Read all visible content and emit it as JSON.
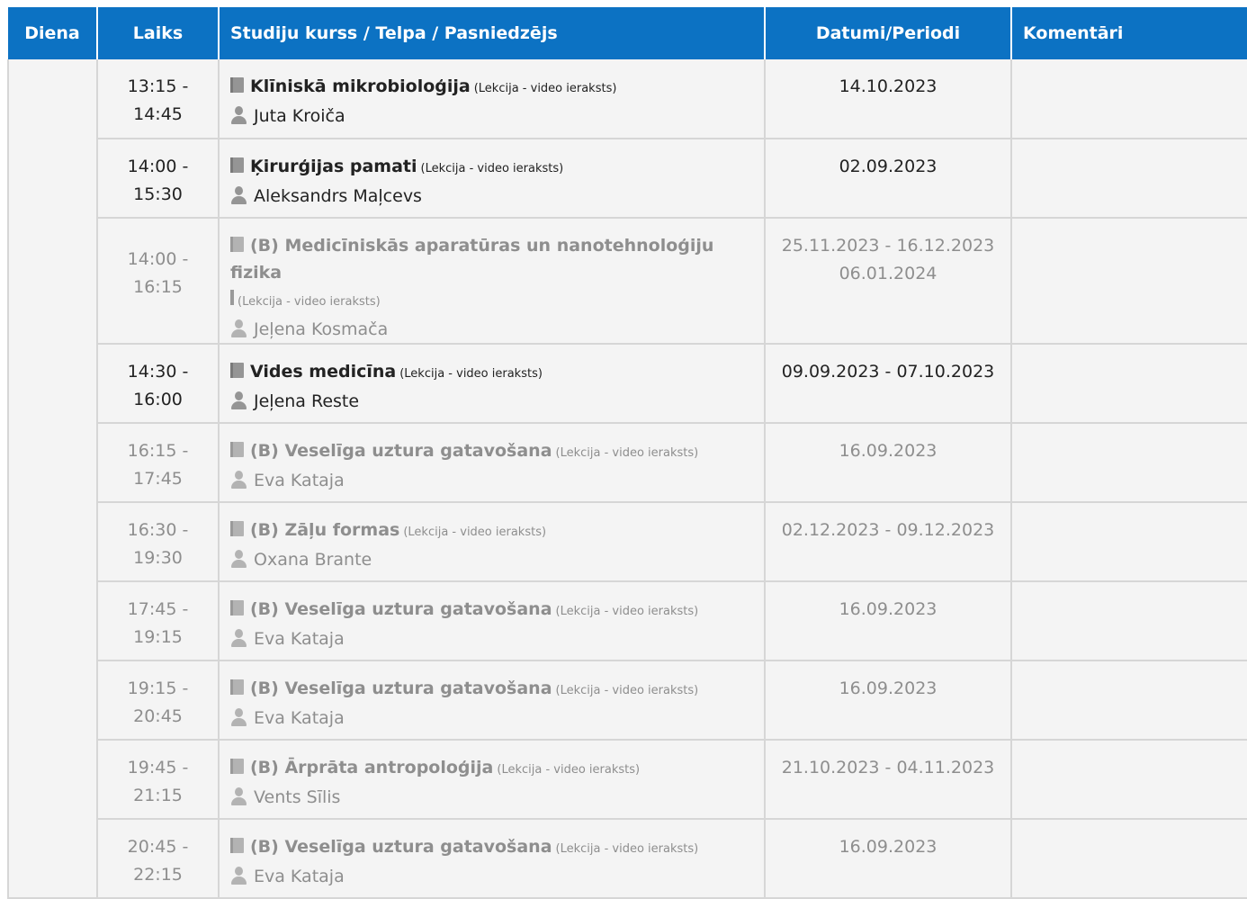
{
  "header": {
    "day": "Diena",
    "time": "Laiks",
    "course": "Studiju kurss / Telpa / Pasniedzējs",
    "dates": "Datumi/Periodi",
    "comments": "Komentāri"
  },
  "colors": {
    "header_bg": "#0c72c3",
    "cell_bg": "#f4f4f4",
    "dim_text": "#8e8e8e"
  },
  "rows": [
    {
      "time_start": "13:15 -",
      "time_end": "14:45",
      "course": "Klīniskā mikrobioloģija",
      "type": "(Lekcija - video ieraksts)",
      "teacher": "Juta Kroiča",
      "dates": "14.10.2023",
      "dates2": "",
      "dim": false
    },
    {
      "time_start": "14:00 -",
      "time_end": "15:30",
      "course": "Ķirurģijas pamati",
      "type": "(Lekcija - video ieraksts)",
      "teacher": "Aleksandrs Maļcevs",
      "dates": "02.09.2023",
      "dates2": "",
      "dim": false
    },
    {
      "time_start": "14:00 -",
      "time_end": "16:15",
      "course": "(B) Medicīniskās aparatūras un nanotehnoloģiju fizika",
      "type": "(Lekcija - video ieraksts)",
      "teacher": "Jeļena Kosmača",
      "dates": "25.11.2023 - 16.12.2023",
      "dates2": "06.01.2024",
      "dim": true
    },
    {
      "time_start": "14:30 -",
      "time_end": "16:00",
      "course": "Vides medicīna",
      "type": "(Lekcija - video ieraksts)",
      "teacher": "Jeļena Reste",
      "dates": "09.09.2023 - 07.10.2023",
      "dates2": "",
      "dim": false
    },
    {
      "time_start": "16:15 -",
      "time_end": "17:45",
      "course": "(B) Veselīga uztura gatavošana",
      "type": "(Lekcija - video ieraksts)",
      "teacher": "Eva Kataja",
      "dates": "16.09.2023",
      "dates2": "",
      "dim": true
    },
    {
      "time_start": "16:30 -",
      "time_end": "19:30",
      "course": "(B) Zāļu formas",
      "type": "(Lekcija - video ieraksts)",
      "teacher": "Oxana Brante",
      "dates": "02.12.2023 - 09.12.2023",
      "dates2": "",
      "dim": true
    },
    {
      "time_start": "17:45 -",
      "time_end": "19:15",
      "course": "(B) Veselīga uztura gatavošana",
      "type": "(Lekcija - video ieraksts)",
      "teacher": "Eva Kataja",
      "dates": "16.09.2023",
      "dates2": "",
      "dim": true
    },
    {
      "time_start": "19:15 -",
      "time_end": "20:45",
      "course": "(B) Veselīga uztura gatavošana",
      "type": "(Lekcija - video ieraksts)",
      "teacher": "Eva Kataja",
      "dates": "16.09.2023",
      "dates2": "",
      "dim": true
    },
    {
      "time_start": "19:45 -",
      "time_end": "21:15",
      "course": "(B) Ārprāta antropoloģija",
      "type": "(Lekcija - video ieraksts)",
      "teacher": "Vents Sīlis",
      "dates": "21.10.2023 - 04.11.2023",
      "dates2": "",
      "dim": true
    },
    {
      "time_start": "20:45 -",
      "time_end": "22:15",
      "course": "(B) Veselīga uztura gatavošana",
      "type": "(Lekcija - video ieraksts)",
      "teacher": "Eva Kataja",
      "dates": "16.09.2023",
      "dates2": "",
      "dim": true
    }
  ]
}
